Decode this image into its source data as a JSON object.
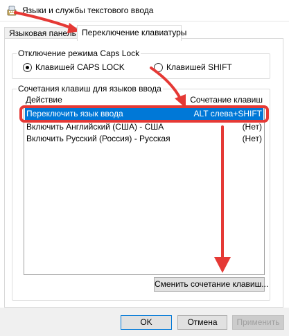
{
  "window": {
    "title": "Языки и службы текстового ввода",
    "icon": "keyboard-icon"
  },
  "tabs": [
    {
      "label": "Языковая панель",
      "selected": false
    },
    {
      "label": "Переключение клавиатуры",
      "selected": true
    }
  ],
  "caps_group": {
    "label": "Отключение режима Caps Lock",
    "options": [
      {
        "label": "Клавишей CAPS LOCK",
        "checked": true
      },
      {
        "label": "Клавишей SHIFT",
        "checked": false
      }
    ]
  },
  "hotkeys_group": {
    "label": "Сочетания клавиш для языков ввода",
    "columns": {
      "action": "Действие",
      "shortcut": "Сочетание клавиш"
    },
    "rows": [
      {
        "action": "Переключить язык ввода",
        "shortcut": "ALT слева+SHIFT",
        "selected": true
      },
      {
        "action": "Включить Английский (США) - США",
        "shortcut": "(Нет)",
        "selected": false
      },
      {
        "action": "Включить Русский (Россия) - Русская",
        "shortcut": "(Нет)",
        "selected": false
      }
    ],
    "change_button": "Сменить сочетание клавиш..."
  },
  "buttons": {
    "ok": "OK",
    "cancel": "Отмена",
    "apply": "Применить"
  },
  "colors": {
    "selection": "#0078d7",
    "annotation": "#e53935"
  }
}
